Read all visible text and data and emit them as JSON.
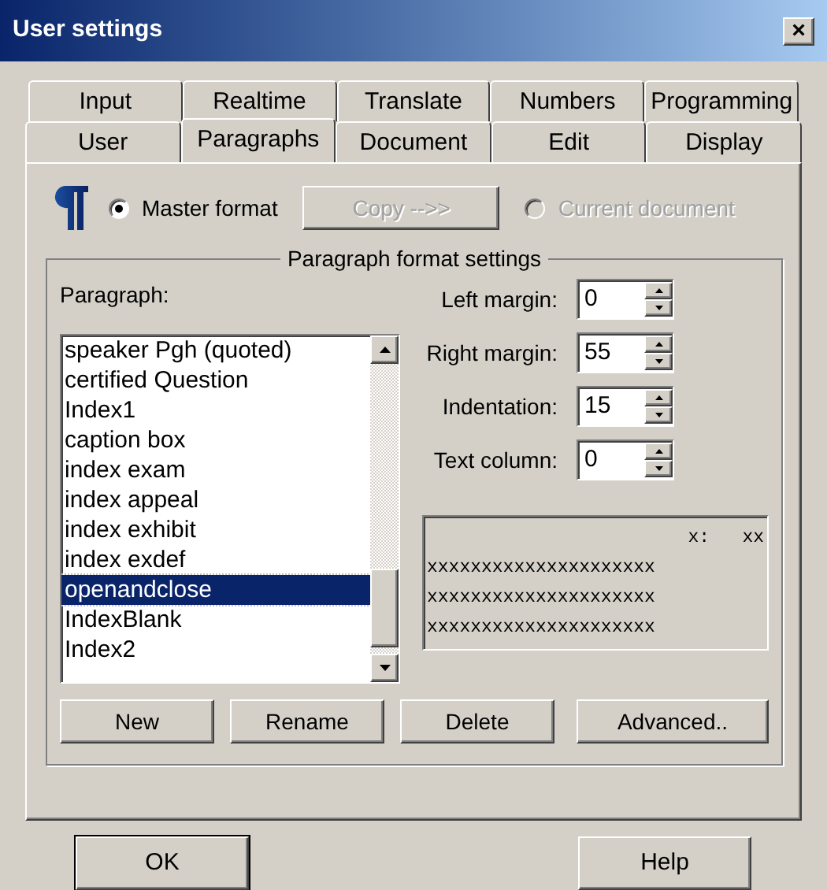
{
  "window": {
    "title": "User settings",
    "close": "×"
  },
  "tab_rows": [
    [
      {
        "label": "Input",
        "selected": false
      },
      {
        "label": "Realtime",
        "selected": false
      },
      {
        "label": "Translate",
        "selected": false
      },
      {
        "label": "Numbers",
        "selected": false
      },
      {
        "label": "Programming",
        "selected": false
      }
    ],
    [
      {
        "label": "User",
        "selected": false
      },
      {
        "label": "Paragraphs",
        "selected": true
      },
      {
        "label": "Document",
        "selected": false
      },
      {
        "label": "Edit",
        "selected": false
      },
      {
        "label": "Display",
        "selected": false
      }
    ]
  ],
  "format_source": [
    {
      "kind": "radio",
      "label": "Master format",
      "selected": true,
      "disabled": false
    },
    {
      "kind": "button",
      "label": "Copy -->>",
      "disabled": true
    },
    {
      "kind": "radio",
      "label": "Current document",
      "selected": false,
      "disabled": true
    }
  ],
  "group": {
    "title": "Paragraph format settings"
  },
  "paragraph_list": {
    "label": "Paragraph:",
    "items": [
      {
        "text": "speaker Pgh (quoted)",
        "selected": false
      },
      {
        "text": "certified Question",
        "selected": false
      },
      {
        "text": "Index1",
        "selected": false
      },
      {
        "text": "caption box",
        "selected": false
      },
      {
        "text": "index exam",
        "selected": false
      },
      {
        "text": "index appeal",
        "selected": false
      },
      {
        "text": "index exhibit",
        "selected": false
      },
      {
        "text": "index exdef",
        "selected": false
      },
      {
        "text": "openandclose",
        "selected": true
      },
      {
        "text": "IndexBlank",
        "selected": false
      },
      {
        "text": "Index2",
        "selected": false
      }
    ]
  },
  "spinners": [
    {
      "label": "Left margin:",
      "value": "0"
    },
    {
      "label": "Right margin:",
      "value": "55"
    },
    {
      "label": "Indentation:",
      "value": "15"
    },
    {
      "label": "Text column:",
      "value": "0"
    }
  ],
  "preview": [
    "x:   xx",
    "xxxxxxxxxxxxxxxxxxxxx",
    "xxxxxxxxxxxxxxxxxxxxx",
    "xxxxxxxxxxxxxxxxxxxxx"
  ],
  "group_buttons": [
    "New",
    "Rename",
    "Delete",
    "Advanced.."
  ],
  "footer_buttons": [
    {
      "label": "OK",
      "kind": "default"
    },
    {
      "label": "Help",
      "kind": "normal"
    }
  ]
}
